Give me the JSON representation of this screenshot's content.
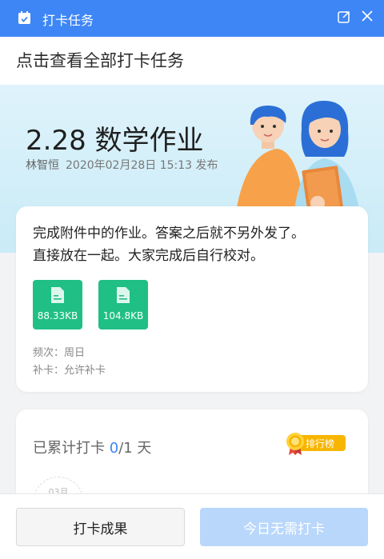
{
  "window": {
    "title": "打卡任务",
    "icons": [
      "calendar-icon",
      "open-external-icon",
      "close-icon"
    ]
  },
  "view_all": {
    "label": "点击查看全部打卡任务"
  },
  "task": {
    "title": "2.28 数学作业",
    "author": "林智恒",
    "published": "2020年02月28日 15:13 发布",
    "content_line1": "完成附件中的作业。答案之后就不另外发了。",
    "content_line2": "直接放在一起。大家完成后自行校对。",
    "attachments": [
      {
        "size": "88.33KB"
      },
      {
        "size": "104.8KB"
      }
    ],
    "frequency": "频次：周日",
    "makeup": "补卡：允许补卡"
  },
  "progress": {
    "prefix": "已累计打卡 ",
    "done": "0",
    "total_suffix": "/1 天",
    "ranking_label": "排行榜",
    "month_label": "03月"
  },
  "footer": {
    "result_button": "打卡成果",
    "today_button": "今日无需打卡"
  },
  "colors": {
    "titlebar": "#3e86f6",
    "accent": "#3e86f6",
    "file_green": "#1fbf85",
    "ranking_gold": "#f7b500",
    "disabled_button": "#b9d7fb"
  }
}
